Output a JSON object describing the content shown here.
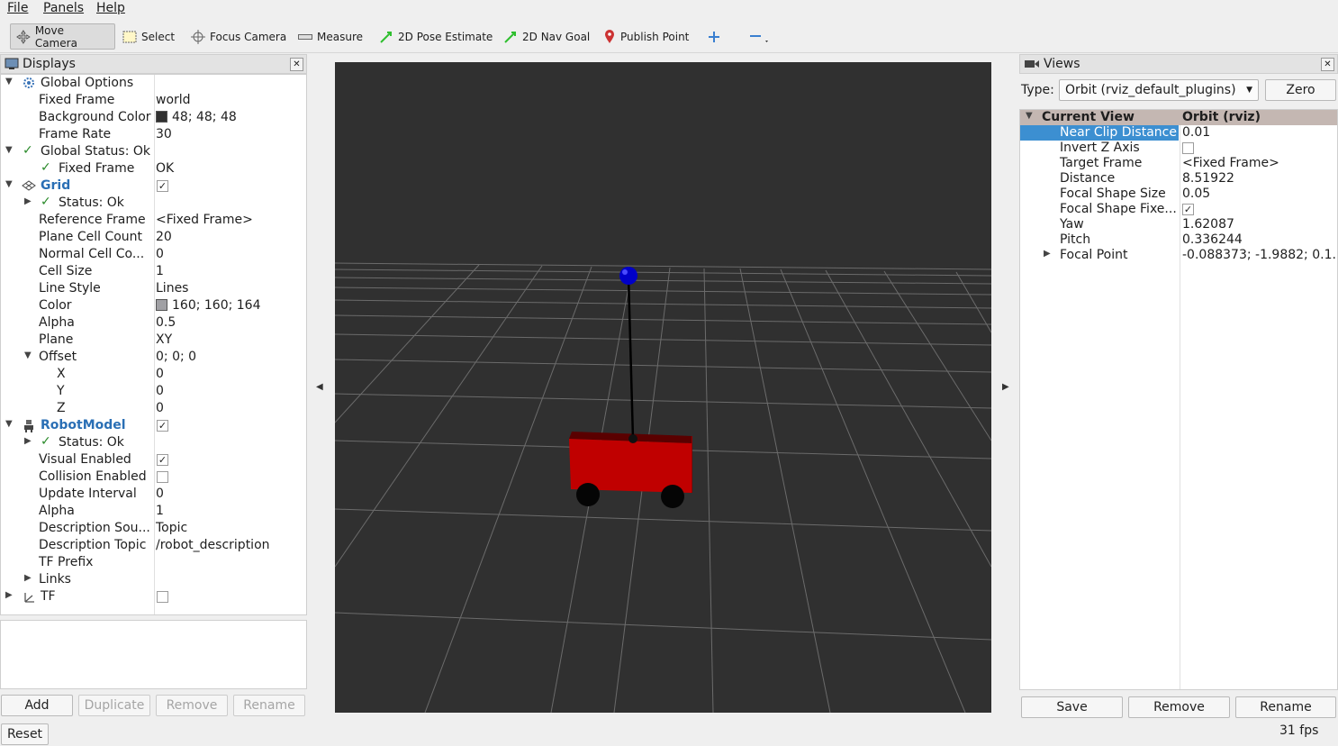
{
  "menu": {
    "file": "File",
    "panels": "Panels",
    "help": "Help"
  },
  "toolbar": {
    "move_camera": "Move Camera",
    "select": "Select",
    "focus_camera": "Focus Camera",
    "measure": "Measure",
    "pose_estimate": "2D Pose Estimate",
    "nav_goal": "2D Nav Goal",
    "publish_point": "Publish Point"
  },
  "displays": {
    "title": "Displays",
    "global_options": "Global Options",
    "fixed_frame_label": "Fixed Frame",
    "fixed_frame_value": "world",
    "bg_color_label": "Background Color",
    "bg_color_value": "48; 48; 48",
    "frame_rate_label": "Frame Rate",
    "frame_rate_value": "30",
    "global_status": "Global Status: Ok",
    "gs_fixed_frame_label": "Fixed Frame",
    "gs_fixed_frame_value": "OK",
    "grid": "Grid",
    "grid_status": "Status: Ok",
    "ref_frame_label": "Reference Frame",
    "ref_frame_value": "<Fixed Frame>",
    "plane_cell_count_label": "Plane Cell Count",
    "plane_cell_count_value": "20",
    "normal_cell_label": "Normal Cell Co...",
    "normal_cell_value": "0",
    "cell_size_label": "Cell Size",
    "cell_size_value": "1",
    "line_style_label": "Line Style",
    "line_style_value": "Lines",
    "color_label": "Color",
    "color_value": "160; 160; 164",
    "alpha_label": "Alpha",
    "alpha_value": "0.5",
    "plane_label": "Plane",
    "plane_value": "XY",
    "offset_label": "Offset",
    "offset_value": "0; 0; 0",
    "x_label": "X",
    "x_value": "0",
    "y_label": "Y",
    "y_value": "0",
    "z_label": "Z",
    "z_value": "0",
    "robot_model": "RobotModel",
    "rm_status": "Status: Ok",
    "visual_enabled": "Visual Enabled",
    "collision_enabled": "Collision Enabled",
    "update_interval_label": "Update Interval",
    "update_interval_value": "0",
    "rm_alpha_label": "Alpha",
    "rm_alpha_value": "1",
    "desc_source_label": "Description Sou...",
    "desc_source_value": "Topic",
    "desc_topic_label": "Description Topic",
    "desc_topic_value": "/robot_description",
    "tf_prefix": "TF Prefix",
    "links": "Links",
    "tf": "TF"
  },
  "display_buttons": {
    "add": "Add",
    "duplicate": "Duplicate",
    "remove": "Remove",
    "rename": "Rename"
  },
  "reset": "Reset",
  "views": {
    "title": "Views",
    "type_label": "Type:",
    "type_value": "Orbit (rviz_default_plugins)",
    "zero": "Zero",
    "current_view": "Current View",
    "current_view_value": "Orbit (rviz)",
    "near_clip_label": "Near Clip Distance",
    "near_clip_value": "0.01",
    "invert_z": "Invert Z Axis",
    "target_frame_label": "Target Frame",
    "target_frame_value": "<Fixed Frame>",
    "distance_label": "Distance",
    "distance_value": "8.51922",
    "focal_size_label": "Focal Shape Size",
    "focal_size_value": "0.05",
    "focal_fixed_label": "Focal Shape Fixe...",
    "yaw_label": "Yaw",
    "yaw_value": "1.62087",
    "pitch_label": "Pitch",
    "pitch_value": "0.336244",
    "focal_point_label": "Focal Point",
    "focal_point_value": "-0.088373; -1.9882; 0.1..."
  },
  "view_buttons": {
    "save": "Save",
    "remove": "Remove",
    "rename": "Rename"
  },
  "fps": "31 fps",
  "colors": {
    "background": "#303030",
    "grid_color": "#a0a0a4",
    "robot_body": "#c00000",
    "marker": "#0000c8",
    "selection": "#3c8fd1"
  }
}
